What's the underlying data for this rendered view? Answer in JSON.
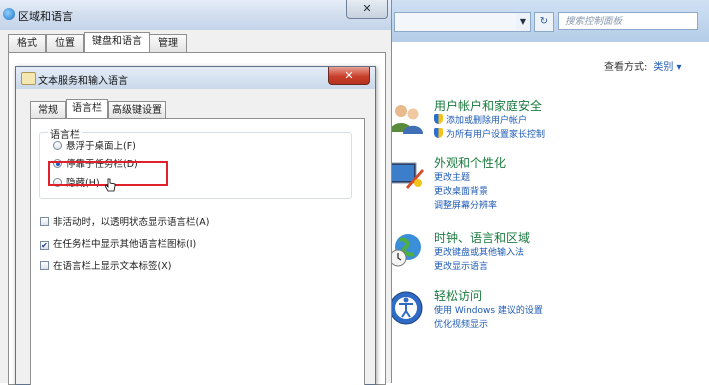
{
  "control_panel": {
    "search_placeholder": "搜索控制面板",
    "view_by_label": "查看方式:",
    "view_by_value": "类别 ▾",
    "categories": [
      {
        "title": "用户帐户和家庭安全",
        "links": [
          "添加或删除用户帐户",
          "为所有用户设置家长控制"
        ],
        "shield_links": [
          true,
          true
        ],
        "icon": "users-icon"
      },
      {
        "title": "外观和个性化",
        "links": [
          "更改主题",
          "更改桌面背景",
          "调整屏幕分辨率"
        ],
        "icon": "appearance-icon"
      },
      {
        "title": "时钟、语言和区域",
        "links": [
          "更改键盘或其他输入法",
          "更改显示语言"
        ],
        "icon": "clock-globe-icon"
      },
      {
        "title": "轻松访问",
        "links": [
          "使用 Windows 建议的设置",
          "优化视频显示"
        ],
        "icon": "ease-of-access-icon"
      }
    ]
  },
  "region_window": {
    "title": "区域和语言",
    "tabs": [
      "格式",
      "位置",
      "键盘和语言",
      "管理"
    ],
    "active_tab": "键盘和语言"
  },
  "text_services": {
    "title": "文本服务和输入语言",
    "tabs": [
      "常规",
      "语言栏",
      "高级键设置"
    ],
    "active_tab": "语言栏",
    "group_label": "语言栏",
    "radio_options": [
      "悬浮于桌面上(F)",
      "停靠于任务栏(D)",
      "隐藏(H)"
    ],
    "selected_option": "停靠于任务栏(D)",
    "checkboxes": [
      {
        "label": "非活动时，以透明状态显示语言栏(A)",
        "checked": false
      },
      {
        "label": "在任务栏中显示其他语言栏图标(I)",
        "checked": true
      },
      {
        "label": "在语言栏上显示文本标签(X)",
        "checked": false
      }
    ]
  },
  "colors": {
    "highlight": "#e0202a",
    "link": "#1e5bb5",
    "category_title": "#1a7a3e"
  }
}
